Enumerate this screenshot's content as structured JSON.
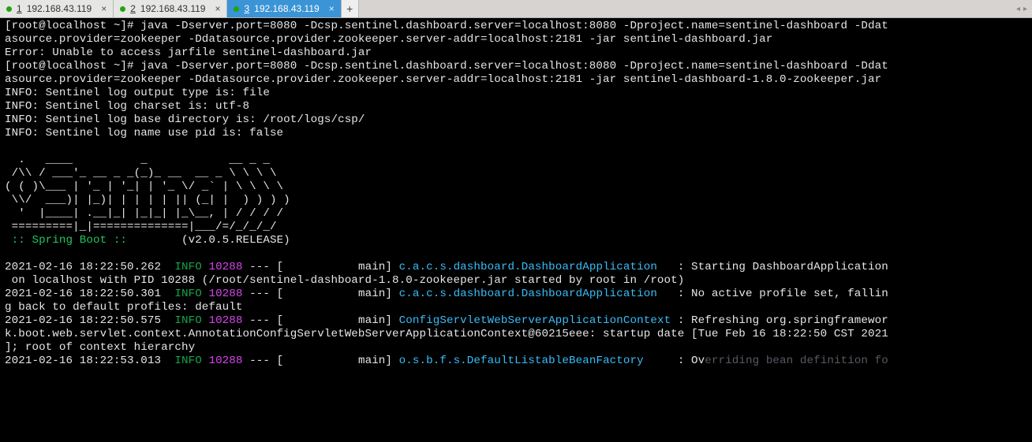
{
  "tabs": [
    {
      "num": "1",
      "label": "192.168.43.119",
      "active": false
    },
    {
      "num": "2",
      "label": "192.168.43.119",
      "active": false
    },
    {
      "num": "3",
      "label": "192.168.43.119",
      "active": true
    }
  ],
  "scroll": {
    "left": "◂",
    "right": "▸"
  },
  "term": {
    "prompt1": "[root@localhost ~]# ",
    "cmd1a": "java -Dserver.port=8080 -Dcsp.sentinel.dashboard.server=localhost:8080 -Dproject.name=sentinel-dashboard -Ddat",
    "cmd1b": "asource.provider=zookeeper -Ddatasource.provider.zookeeper.server-addr=localhost:2181 -jar sentinel-dashboard.jar",
    "err1": "Error: Unable to access jarfile sentinel-dashboard.jar",
    "prompt2": "[root@localhost ~]# ",
    "cmd2a": "java -Dserver.port=8080 -Dcsp.sentinel.dashboard.server=localhost:8080 -Dproject.name=sentinel-dashboard -Ddat",
    "cmd2b": "asource.provider=zookeeper -Ddatasource.provider.zookeeper.server-addr=localhost:2181 -jar sentinel-dashboard-1.8.0-zookeeper.jar",
    "info1": "INFO: Sentinel log output type is: file",
    "info2": "INFO: Sentinel log charset is: utf-8",
    "info3": "INFO: Sentinel log base directory is: /root/logs/csp/",
    "info4": "INFO: Sentinel log name use pid is: false",
    "banner1": "  .   ____          _            __ _ _",
    "banner2": " /\\\\ / ___'_ __ _ _(_)_ __  __ _ \\ \\ \\ \\",
    "banner3": "( ( )\\___ | '_ | '_| | '_ \\/ _` | \\ \\ \\ \\",
    "banner4": " \\\\/  ___)| |_)| | | | | || (_| |  ) ) ) )",
    "banner5": "  '  |____| .__|_| |_|_| |_\\__, | / / / /",
    "banner6": " =========|_|==============|___/=/_/_/_/",
    "spring1": " :: Spring Boot ::",
    "spring2": "        (v2.0.5.RELEASE)",
    "log1_ts": "2021-02-16 18:22:50.262",
    "log2_ts": "2021-02-16 18:22:50.301",
    "log3_ts": "2021-02-16 18:22:50.575",
    "log4_ts": "2021-02-16 18:22:53.013",
    "level": "INFO",
    "pid": "10288",
    "thread": " --- [           main] ",
    "logger_app": "c.a.c.s.dashboard.DashboardApplication  ",
    "logger_cfg": "ConfigServletWebServerApplicationContext",
    "logger_bf": "o.s.b.f.s.DefaultListableBeanFactory    ",
    "msg1a": " : Starting DashboardApplication",
    "msg1b": " on localhost with PID 10288 (/root/sentinel-dashboard-1.8.0-zookeeper.jar started by root in /root)",
    "msg2a": " : No active profile set, fallin",
    "msg2b": "g back to default profiles: default",
    "msg3a": " : Refreshing org.springframewor",
    "msg3b": "k.boot.web.servlet.context.AnnotationConfigServletWebServerApplicationContext@60215eee: startup date [Tue Feb 16 18:22:50 CST 2021",
    "msg3c": "]; root of context hierarchy",
    "msg4a": " : Ov",
    "watermark": "erriding bean definition fo",
    "msg4b": ""
  }
}
